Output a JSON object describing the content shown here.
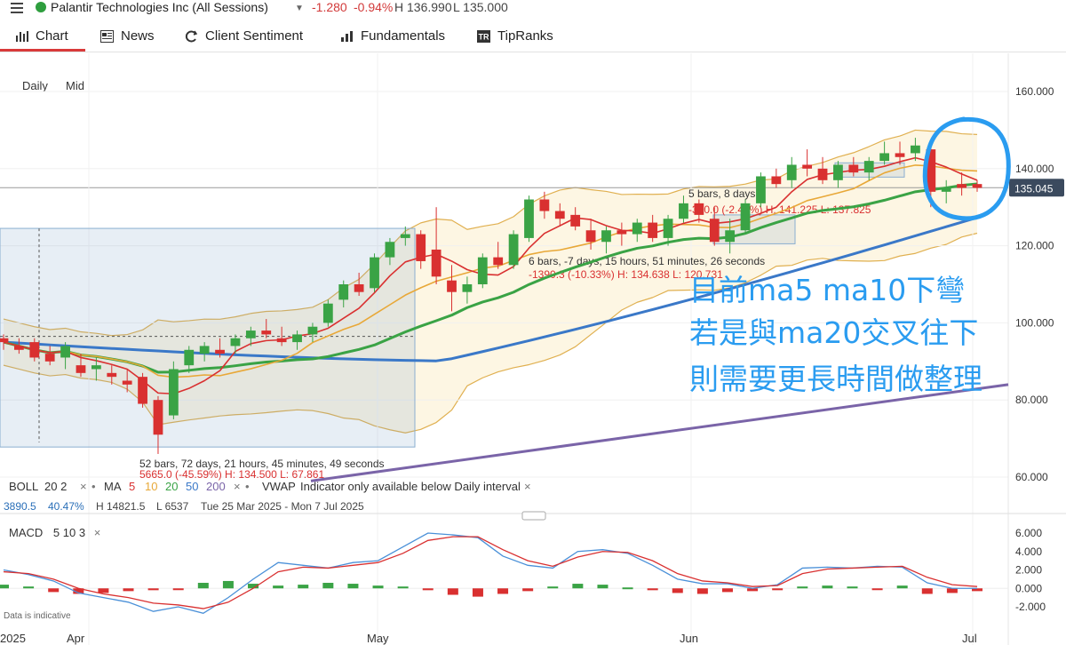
{
  "header": {
    "ticker": "Palantir Technologies Inc (All Sessions)",
    "change": "-1.280",
    "change_pct": "-0.94%",
    "high": "H 136.990",
    "low": "L 135.000",
    "status_color": "#2e9e3e"
  },
  "tabs": [
    {
      "label": "Chart",
      "icon": "chart-icon"
    },
    {
      "label": "News",
      "icon": "news-icon"
    },
    {
      "label": "Client Sentiment",
      "icon": "sentiment-icon"
    },
    {
      "label": "Fundamentals",
      "icon": "fundamentals-icon"
    },
    {
      "label": "TipRanks",
      "icon": "tipranks-icon"
    }
  ],
  "intervals": [
    "Daily",
    "Mid"
  ],
  "price_axis": [
    "160.000",
    "140.000",
    "120.000",
    "100.000",
    "80.000",
    "60.000"
  ],
  "current_price": "135.045",
  "x_axis": [
    "2025",
    "Apr",
    "May",
    "Jun",
    "Jul"
  ],
  "measure_boxes": [
    {
      "line1": "52 bars, 72 days, 21 hours, 45 minutes, 49 seconds",
      "line2": "5665.0 (-45.59%)  H: 134.500 L: 67.861"
    },
    {
      "line1": "6 bars, -7 days, 15 hours, 51 minutes, 26 seconds",
      "line2": "-1390.3 (-10.33%)  H: 134.638 L: 120.731"
    },
    {
      "line1": "5 bars, 8 days",
      "line2": "-340.0 (-2.41%)  H: 141.225 L: 137.825"
    }
  ],
  "indicators": {
    "boll": "BOLL",
    "boll_params": "20  2",
    "ma": "MA",
    "ma_periods": [
      {
        "label": "5",
        "color": "#d93030"
      },
      {
        "label": "10",
        "color": "#e8a838"
      },
      {
        "label": "20",
        "color": "#3aa345"
      },
      {
        "label": "50",
        "color": "#3a78c8"
      },
      {
        "label": "200",
        "color": "#7a64a8"
      }
    ],
    "vwap": "VWAP",
    "vwap_note": "Indicator only available below Daily interval",
    "close_icon": "close-icon"
  },
  "stats": {
    "value": "3890.5",
    "pct": "40.47%",
    "high": "H 14821.5",
    "low": "L 6537",
    "range": "Tue 25 Mar 2025 - Mon 7 Jul 2025"
  },
  "macd": {
    "label": "MACD",
    "params": "5  10  3",
    "axis": [
      "6.000",
      "4.000",
      "2.000",
      "0.000",
      "-2.000"
    ]
  },
  "disclaimer": "Data is indicative",
  "annotation": {
    "lines": [
      "目前ma5 ma10下彎",
      "若是與ma20交叉往下",
      "則需要更長時間做整理"
    ],
    "color": "#2a9cf0"
  },
  "chart_data": {
    "type": "candlestick",
    "title": "Palantir Technologies Inc (All Sessions)",
    "interval": "Daily",
    "ylim": [
      55,
      165
    ],
    "y_ticks": [
      60,
      80,
      100,
      120,
      140,
      160
    ],
    "last_price": 135.045,
    "x_labels": [
      "2025",
      "Apr",
      "May",
      "Jun",
      "Jul"
    ],
    "candles_ohlc": [
      [
        96,
        97,
        93,
        95
      ],
      [
        94,
        96,
        92,
        93
      ],
      [
        95,
        96,
        90,
        91
      ],
      [
        92,
        94,
        89,
        90
      ],
      [
        91,
        95,
        88,
        94
      ],
      [
        89,
        92,
        86,
        87
      ],
      [
        88,
        91,
        85,
        89
      ],
      [
        87,
        89,
        84,
        86
      ],
      [
        85,
        88,
        82,
        84
      ],
      [
        86,
        87,
        78,
        79
      ],
      [
        80,
        81,
        66,
        71
      ],
      [
        76,
        90,
        75,
        88
      ],
      [
        89,
        94,
        87,
        93
      ],
      [
        92,
        95,
        90,
        94
      ],
      [
        93,
        96,
        91,
        92
      ],
      [
        94,
        97,
        92,
        96
      ],
      [
        96,
        99,
        94,
        98
      ],
      [
        98,
        101,
        96,
        97
      ],
      [
        96,
        99,
        94,
        95
      ],
      [
        95,
        98,
        93,
        97
      ],
      [
        97,
        100,
        95,
        99
      ],
      [
        100,
        106,
        99,
        105
      ],
      [
        106,
        111,
        104,
        110
      ],
      [
        110,
        113,
        107,
        108
      ],
      [
        109,
        118,
        108,
        117
      ],
      [
        117,
        122,
        115,
        121
      ],
      [
        122,
        125,
        120,
        123
      ],
      [
        123,
        124,
        114,
        116
      ],
      [
        119,
        130,
        110,
        112
      ],
      [
        111,
        115,
        103,
        108
      ],
      [
        108,
        112,
        105,
        110
      ],
      [
        110,
        118,
        109,
        117
      ],
      [
        117,
        121,
        114,
        115
      ],
      [
        115,
        124,
        114,
        123
      ],
      [
        122,
        133,
        121,
        132
      ],
      [
        132,
        134,
        127,
        129
      ],
      [
        129,
        131,
        125,
        127
      ],
      [
        128,
        130,
        124,
        125
      ],
      [
        124,
        127,
        119,
        121
      ],
      [
        121,
        125,
        118,
        124
      ],
      [
        124,
        126,
        120,
        123
      ],
      [
        123,
        127,
        121,
        126
      ],
      [
        126,
        128,
        121,
        122
      ],
      [
        122,
        128,
        120,
        127
      ],
      [
        127,
        133,
        126,
        131
      ],
      [
        131,
        132,
        126,
        128
      ],
      [
        127,
        130,
        120,
        121
      ],
      [
        121,
        127,
        118,
        124
      ],
      [
        124,
        132,
        123,
        131
      ],
      [
        131,
        139,
        130,
        138
      ],
      [
        138,
        140,
        135,
        136
      ],
      [
        137,
        143,
        135,
        141
      ],
      [
        141,
        145,
        138,
        140
      ],
      [
        140,
        143,
        136,
        137
      ],
      [
        137,
        142,
        135,
        141
      ],
      [
        141,
        143,
        138,
        139
      ],
      [
        139,
        143,
        137,
        142
      ],
      [
        142,
        147,
        141,
        144
      ],
      [
        144,
        147,
        141,
        143
      ],
      [
        144,
        148,
        142,
        146
      ],
      [
        145,
        146,
        130,
        134
      ],
      [
        134,
        137,
        131,
        135
      ],
      [
        136,
        139,
        133,
        135
      ],
      [
        136,
        137,
        134,
        135
      ]
    ],
    "series": [
      {
        "name": "MA 5",
        "color": "#d93030"
      },
      {
        "name": "MA 10",
        "color": "#e8a838"
      },
      {
        "name": "MA 20",
        "color": "#3aa345"
      },
      {
        "name": "MA 50",
        "color": "#3a78c8"
      },
      {
        "name": "MA 200",
        "color": "#7a64a8"
      },
      {
        "name": "BOLL 20 2",
        "color": "#e0b050"
      }
    ],
    "macd": {
      "ylim": [
        -3,
        7
      ],
      "dif": [
        2.0,
        1.5,
        0.8,
        -0.5,
        -1.0,
        -1.5,
        -2.5,
        -2.0,
        -2.7,
        -1.0,
        1.0,
        2.8,
        2.5,
        2.2,
        2.8,
        3.0,
        4.5,
        6.0,
        5.8,
        5.5,
        3.5,
        2.5,
        2.2,
        4.0,
        4.2,
        3.8,
        2.5,
        1.0,
        0.5,
        0.5,
        0.0,
        0.4,
        2.2,
        2.3,
        2.2,
        2.4,
        2.3,
        0.6,
        0.0,
        0.0
      ],
      "dea": [
        1.8,
        1.6,
        1.0,
        0.0,
        -0.6,
        -1.0,
        -1.6,
        -1.8,
        -2.2,
        -1.5,
        0.0,
        1.8,
        2.3,
        2.2,
        2.5,
        2.8,
        3.8,
        5.2,
        5.6,
        5.6,
        4.2,
        3.0,
        2.4,
        3.4,
        4.0,
        3.9,
        3.0,
        1.6,
        0.8,
        0.6,
        0.2,
        0.3,
        1.6,
        2.1,
        2.2,
        2.3,
        2.4,
        1.2,
        0.4,
        0.2
      ],
      "histogram": [
        0.4,
        0.2,
        -0.4,
        -0.6,
        -0.5,
        -0.3,
        -0.2,
        -0.1,
        0.6,
        0.8,
        0.5,
        0.3,
        0.4,
        0.6,
        0.5,
        0.3,
        0.2,
        -0.2,
        -0.7,
        -0.9,
        -0.6,
        -0.3,
        0.2,
        0.5,
        0.4,
        0.1,
        -0.2,
        -0.5,
        -0.6,
        -0.4,
        -0.3,
        -0.2,
        0.2,
        0.3,
        0.2,
        -0.1,
        0.3,
        -0.6,
        -0.5,
        -0.3
      ]
    }
  }
}
